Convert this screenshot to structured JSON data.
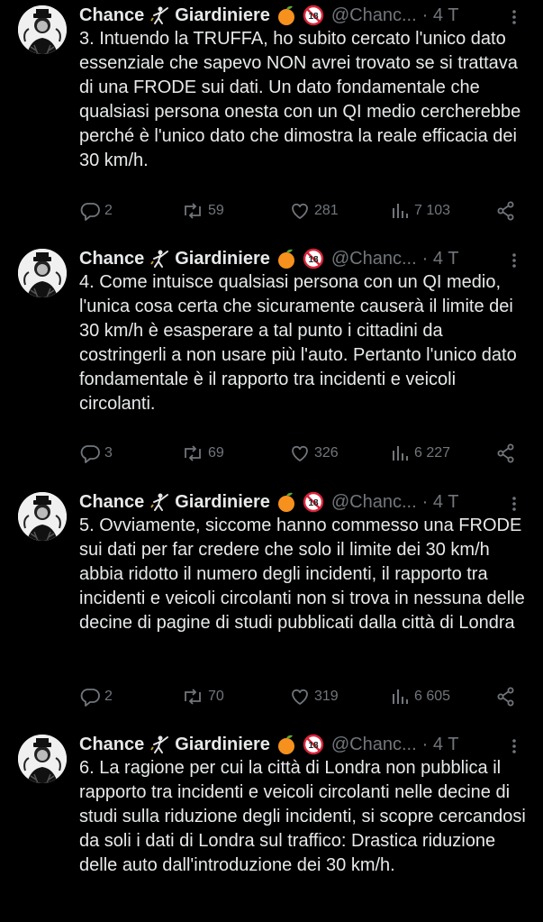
{
  "tweets": [
    {
      "name": "Chance",
      "name2": "Giardiniere",
      "handle": "@Chanc...",
      "time": "· 4 T",
      "text": "3. Intuendo la TRUFFA, ho subito cercato l'unico dato essenziale che sapevo NON avrei trovato se si trattava di una FRODE sui dati. Un dato fondamentale che qualsiasi persona onesta con un QI medio cercherebbe perché è l'unico dato che dimostra la reale efficacia dei 30 km/h.",
      "replies": "2",
      "reposts": "59",
      "likes": "281",
      "views": "7 103"
    },
    {
      "name": "Chance",
      "name2": "Giardiniere",
      "handle": "@Chanc...",
      "time": "· 4 T",
      "text": "4. Come intuisce qualsiasi persona con un QI medio, l'unica cosa certa che sicuramente causerà il limite dei 30 km/h è esasperare a tal punto i cittadini da costringerli a non usare più l'auto. Pertanto l'unico dato fondamentale è il rapporto tra incidenti e veicoli circolanti.",
      "replies": "3",
      "reposts": "69",
      "likes": "326",
      "views": "6 227"
    },
    {
      "name": "Chance",
      "name2": "Giardiniere",
      "handle": "@Chanc...",
      "time": "· 4 T",
      "text": "5. Ovviamente, siccome hanno commesso una FRODE sui dati per far credere che solo il limite dei 30 km/h abbia ridotto il numero degli incidenti, il rapporto tra incidenti e veicoli circolanti non si trova in nessuna delle decine di pagine di studi pubblicati dalla città di Londra",
      "replies": "2",
      "reposts": "70",
      "likes": "319",
      "views": "6 605"
    },
    {
      "name": "Chance",
      "name2": "Giardiniere",
      "handle": "@Chanc...",
      "time": "· 4 T",
      "text": "6. La ragione per cui la città di Londra non pubblica il rapporto tra incidenti e veicoli circolanti nelle decine di studi sulla riduzione degli incidenti, si scopre cercandosi da soli i dati di Londra sul traffico: Drastica riduzione delle auto dall'introduzione dei 30 km/h."
    }
  ],
  "icons": {
    "avatar": "avatar-image",
    "fencer": "fencer-emoji",
    "orange": "orange-emoji",
    "eighteen": "no-under-18-emoji",
    "more": "more-icon",
    "reply": "reply-icon",
    "repost": "repost-icon",
    "like": "like-icon",
    "views": "views-icon",
    "share": "share-icon"
  },
  "colors": {
    "background": "#000000",
    "text": "#e7e9ea",
    "muted": "#71767b"
  }
}
